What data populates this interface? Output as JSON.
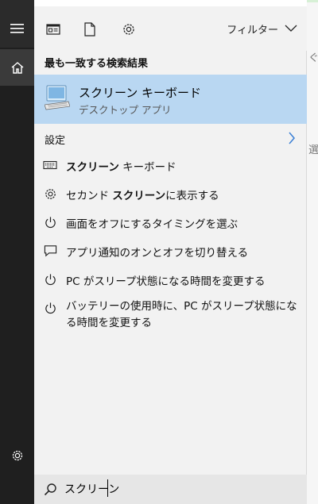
{
  "topbar": {
    "filter_label": "フィルター"
  },
  "best_match": {
    "section_title": "最も一致する検索結果",
    "title": "スクリーン キーボード",
    "subtitle": "デスクトップ アプリ"
  },
  "settings": {
    "section_title": "設定",
    "items": [
      {
        "icon": "keyboard-icon",
        "bold": "スクリーン",
        "rest": " キーボード",
        "prefix": ""
      },
      {
        "icon": "gear-icon",
        "prefix": "セカンド ",
        "bold": "スクリーン",
        "rest": "に表示する"
      },
      {
        "icon": "power-icon",
        "prefix": "",
        "bold": "",
        "rest": "画面をオフにするタイミングを選ぶ"
      },
      {
        "icon": "notification-icon",
        "prefix": "",
        "bold": "",
        "rest": "アプリ通知のオンとオフを切り替える"
      },
      {
        "icon": "power-icon",
        "prefix": "",
        "bold": "",
        "rest": "PC がスリープ状態になる時間を変更する"
      },
      {
        "icon": "power-icon",
        "prefix": "",
        "bold": "",
        "rest": "バッテリーの使用時に、PC がスリープ状態になる時間を変更する"
      }
    ]
  },
  "search": {
    "value": "スクリーン"
  },
  "background": {
    "fragment_1": "ぐ",
    "fragment_2": "選択"
  }
}
